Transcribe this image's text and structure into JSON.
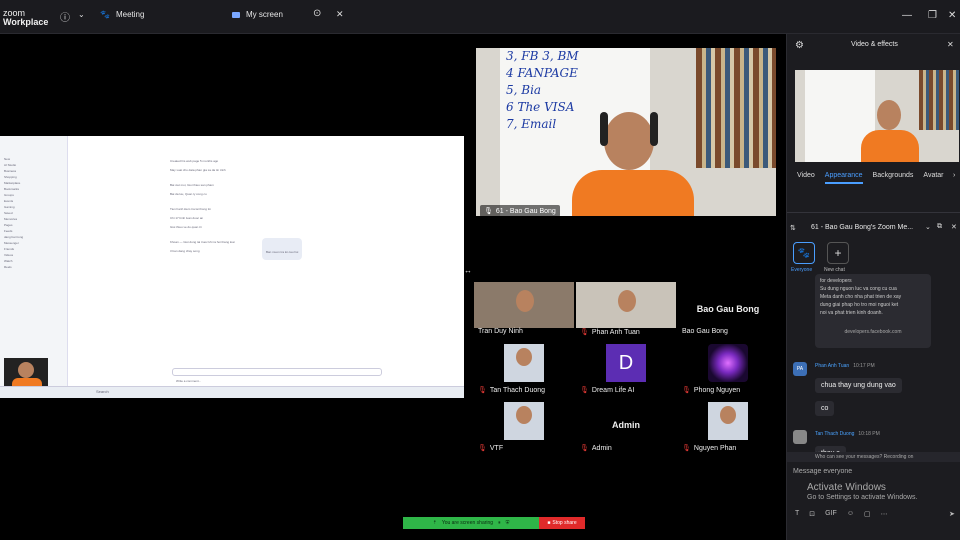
{
  "app": {
    "line1": "zoom",
    "line2": "Workplace"
  },
  "topbar": {
    "meeting_label": "Meeting",
    "myscreen_label": "My screen"
  },
  "shared_screen": {
    "sidebar_items": [
      "New",
      "AI Studio",
      "Business",
      "Shopping",
      "Marketplace",
      "Bookmarks",
      "Groups",
      "Events",
      "Gaming",
      "Saved",
      "Memories",
      "Pages",
      "Feeds",
      "dang bai trong",
      "Messenger",
      "Friends",
      "Videos",
      "Watch",
      "Reels"
    ],
    "posts": [
      "Created his web page 5 months ago",
      "May xuat cho data phan gia xa da tin trinh",
      "Bai viet moi, Gioi thieu san pham",
      "Bai da luu, Quan ly cong cu",
      "Tien hanh kiem tra lai thong tin",
      "Ban muon tra loi cau hoi",
      "Chi 17 binh luan duoc an",
      "Gioi thieu ve do quan tri",
      "Khoan — Gioi dung tai truoc khi ra hoi thang loai",
      "3 ban dang chay song"
    ],
    "comment_placeholder": "Write a comment...",
    "taskbar_search": "Search"
  },
  "big_video": {
    "board_lines": [
      "3, FB 3, BM",
      "4 FANPAGE",
      "5, Bia",
      "6 The VISA",
      "7, Email"
    ],
    "label": "61 - Bao Gau Bong"
  },
  "gallery": [
    {
      "name": "Tran Duy Ninh",
      "muted": false,
      "kind": "video"
    },
    {
      "name": "Phan Anh Tuan",
      "muted": true,
      "kind": "video"
    },
    {
      "name": "Bao Gau Bong",
      "muted": false,
      "kind": "text",
      "big": "Bao Gau Bong"
    },
    {
      "name": "Tan Thach Duong",
      "muted": true,
      "kind": "photo"
    },
    {
      "name": "Dream Life AI",
      "muted": true,
      "kind": "letter",
      "letter": "D"
    },
    {
      "name": "Phong Nguyen",
      "muted": true,
      "kind": "swirl"
    },
    {
      "name": "VTF",
      "muted": true,
      "kind": "photo"
    },
    {
      "name": "Admin",
      "muted": true,
      "kind": "text",
      "big": "Admin"
    },
    {
      "name": "Nguyen Phan",
      "muted": true,
      "kind": "photo"
    }
  ],
  "right_panel": {
    "video_effects_title": "Video & effects",
    "tabs": [
      "Video",
      "Appearance",
      "Backgrounds",
      "Avatar"
    ],
    "active_tab": "Appearance",
    "chat_title": "61 - Bao Gau Bong's Zoom Me...",
    "recipients": [
      "Everyone",
      "New chat"
    ],
    "shared_card": {
      "lines": [
        "for developers",
        "Su dung nguon luc va cong cu cua",
        "Meta danh cho nha phat trien de xay",
        "dung giai phap ho tro moi nguoi ket",
        "noi va phat trien kinh doanh."
      ],
      "link": "developers.facebook.com"
    },
    "messages": [
      {
        "name": "Phan Anh Tuan",
        "time": "10:17 PM",
        "avatar": "PA",
        "texts": [
          "chua thay ung dung vao",
          "co"
        ]
      },
      {
        "name": "Tan Thach Duong",
        "time": "10:18 PM",
        "avatar": "",
        "texts": [
          "thay a"
        ]
      }
    ],
    "visibility_note": "Who can see your messages? Recording on",
    "message_placeholder": "Message everyone",
    "activate_title": "Activate Windows",
    "activate_sub": "Go to Settings to activate Windows."
  },
  "bottom_bar": {
    "sharing_label": "You are screen sharing",
    "stop_label": "Stop share"
  },
  "colors": {
    "accent": "#4a9eff",
    "share_green": "#2fb648",
    "stop_red": "#e02a2a",
    "shirt_orange": "#f07a22"
  }
}
